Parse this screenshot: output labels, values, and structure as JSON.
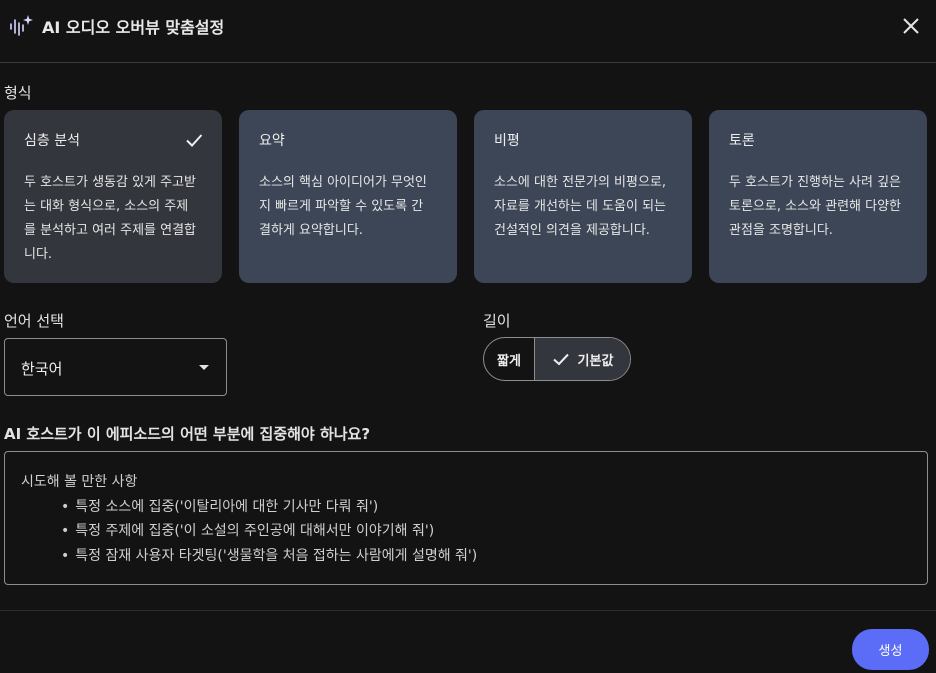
{
  "header": {
    "title": "AI 오디오 오버뷰 맞춤설정",
    "icon": "audio-sparkle-icon",
    "close_icon": "close-icon"
  },
  "format": {
    "label": "형식",
    "cards": [
      {
        "title": "심층 분석",
        "desc": [
          "두 호스트가 생동감 있게 주고받",
          "는 대화 형식으로, 소스의 주제",
          "를 분석하고 여러 주제를 연결합",
          "니다."
        ],
        "selected": true
      },
      {
        "title": "요약",
        "desc": [
          "소스의 핵심 아이디어가 무엇인",
          "지 빠르게 파악할 수 있도록 간",
          "결하게 요약합니다."
        ],
        "selected": false
      },
      {
        "title": "비평",
        "desc": [
          "소스에 대한 전문가의 비평으로,",
          "자료를 개선하는 데 도움이 되는",
          "건설적인 의견을 제공합니다."
        ],
        "selected": false
      },
      {
        "title": "토론",
        "desc": [
          "두 호스트가 진행하는 사려 깊은",
          "토론으로, 소스와 관련해 다양한",
          "관점을 조명합니다."
        ],
        "selected": false
      }
    ]
  },
  "language": {
    "label": "언어 선택",
    "value": "한국어"
  },
  "length": {
    "label": "길이",
    "options": [
      "짧게",
      "기본값"
    ],
    "selected": "기본값"
  },
  "focus": {
    "label": "AI 호스트가 이 에피소드의 어떤 부분에 집중해야 하나요?",
    "placeholder_title": "시도해 볼 만한 사항",
    "placeholder_items": [
      "특정 소스에 집중('이탈리아에 대한 기사만 다뤄 줘')",
      "특정 주제에 집중('이 소설의 주인공에 대해서만 이야기해 줘')",
      "특정 잠재 사용자 타겟팅('생물학을 처음 접하는 사람에게 설명해 줘')"
    ]
  },
  "actions": {
    "generate_label": "생성"
  },
  "colors": {
    "accent": "#5b6cf7",
    "card_bg": "#3c4656",
    "card_selected_bg": "#34363d",
    "background": "#131314"
  }
}
